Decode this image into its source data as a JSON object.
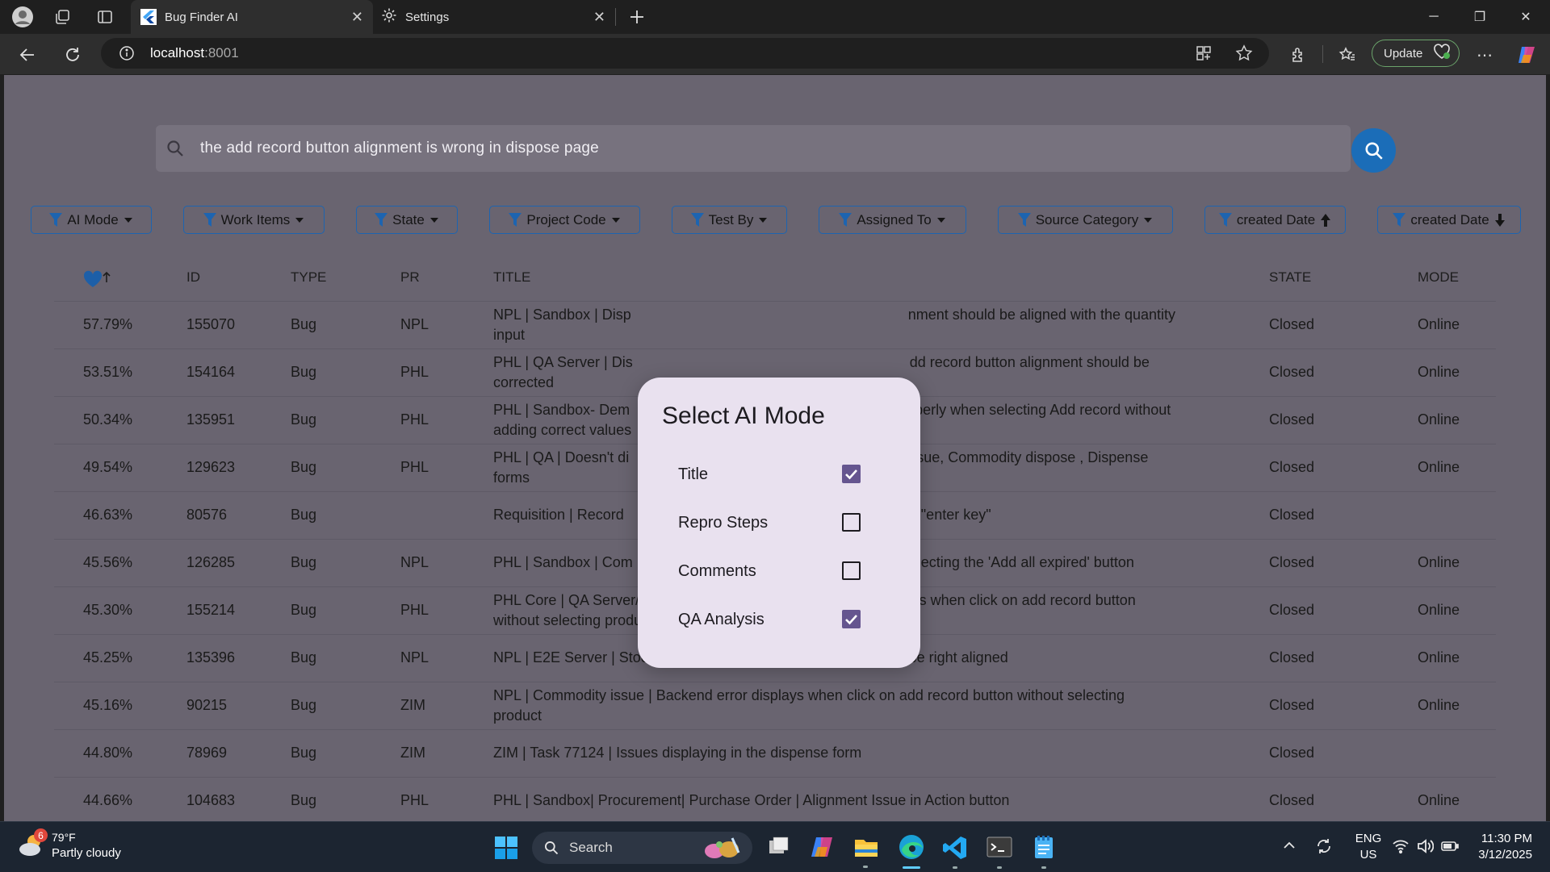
{
  "browser": {
    "tabs": [
      {
        "label": "Bug Finder AI",
        "active": true
      },
      {
        "label": "Settings",
        "active": false
      }
    ],
    "url_host": "localhost",
    "url_port": ":8001",
    "update_label": "Update"
  },
  "search": {
    "query": "the add record button alignment is wrong in dispose page"
  },
  "filters": [
    {
      "label": "AI Mode",
      "suffix": "dropdown"
    },
    {
      "label": "Work Items",
      "suffix": "dropdown"
    },
    {
      "label": "State",
      "suffix": "dropdown"
    },
    {
      "label": "Project Code",
      "suffix": "dropdown"
    },
    {
      "label": "Test By",
      "suffix": "dropdown"
    },
    {
      "label": "Assigned To",
      "suffix": "dropdown"
    },
    {
      "label": "Source Category",
      "suffix": "dropdown"
    },
    {
      "label": "created Date",
      "suffix": "sort-up"
    },
    {
      "label": "created Date",
      "suffix": "sort-down"
    }
  ],
  "table": {
    "columns": [
      "ID",
      "TYPE",
      "PR",
      "TITLE",
      "STATE",
      "MODE"
    ],
    "rows": [
      {
        "score": "57.79%",
        "id": "155070",
        "type": "Bug",
        "pr": "NPL",
        "title_left": "NPL | Sandbox | Disp",
        "title_right": "nment should be aligned with the quantity",
        "title_line2": "input",
        "state": "Closed",
        "mode": "Online"
      },
      {
        "score": "53.51%",
        "id": "154164",
        "type": "Bug",
        "pr": "PHL",
        "title_left": "PHL | QA Server | Dis",
        "title_right": "dd record button alignment should be",
        "title_line2": "corrected",
        "state": "Closed",
        "mode": "Online"
      },
      {
        "score": "50.34%",
        "id": "135951",
        "type": "Bug",
        "pr": "PHL",
        "title_left": "PHL | Sandbox- Dem",
        "title_right": "operly when selecting Add record  without",
        "title_line2": "adding correct values",
        "state": "Closed",
        "mode": "Online"
      },
      {
        "score": "49.54%",
        "id": "129623",
        "type": "Bug",
        "pr": "PHL",
        "title_left": "PHL | QA | Doesn't di",
        "title_right": "issue, Commodity dispose , Dispense",
        "title_line2": "forms",
        "state": "Closed",
        "mode": "Online"
      },
      {
        "score": "46.63%",
        "id": "80576",
        "type": "Bug",
        "pr": "",
        "title_left": "Requisition | Record",
        "title_right": "he \"enter key\"",
        "title_line2": "",
        "state": "Closed",
        "mode": ""
      },
      {
        "score": "45.56%",
        "id": "126285",
        "type": "Bug",
        "pr": "NPL",
        "title_left": "PHL | Sandbox | Com",
        "title_right": "electing the 'Add all expired' button",
        "title_line2": "",
        "state": "Closed",
        "mode": "Online"
      },
      {
        "score": "45.30%",
        "id": "155214",
        "type": "Bug",
        "pr": "PHL",
        "title_left": "PHL Core | QA Server/Live | Allocation List | Backend error displays when click on add record button",
        "title_right": "",
        "title_line2": "without selecting product details",
        "state": "Closed",
        "mode": "Online"
      },
      {
        "score": "45.25%",
        "id": "135396",
        "type": "Bug",
        "pr": "NPL",
        "title_left": "NPL | E2E Server | Stock Adjustment  | Add record button should be right aligned",
        "title_right": "",
        "title_line2": "",
        "state": "Closed",
        "mode": "Online"
      },
      {
        "score": "45.16%",
        "id": "90215",
        "type": "Bug",
        "pr": "ZIM",
        "title_left": "NPL | Commodity issue | Backend error displays when click on add record button without selecting",
        "title_right": "",
        "title_line2": "product",
        "state": "Closed",
        "mode": "Online"
      },
      {
        "score": "44.80%",
        "id": "78969",
        "type": "Bug",
        "pr": "ZIM",
        "title_left": "ZIM | Task 77124 | Issues displaying in the dispense form",
        "title_right": "",
        "title_line2": "",
        "state": "Closed",
        "mode": ""
      },
      {
        "score": "44.66%",
        "id": "104683",
        "type": "Bug",
        "pr": "PHL",
        "title_left": "PHL | Sandbox| Procurement| Purchase Order | Alignment Issue in Action button",
        "title_right": "",
        "title_line2": "",
        "state": "Closed",
        "mode": "Online"
      }
    ]
  },
  "modal": {
    "title": "Select AI Mode",
    "options": [
      {
        "label": "Title",
        "checked": true
      },
      {
        "label": "Repro Steps",
        "checked": false
      },
      {
        "label": "Comments",
        "checked": false
      },
      {
        "label": "QA Analysis",
        "checked": true
      }
    ]
  },
  "taskbar": {
    "weather_temp": "79°F",
    "weather_desc": "Partly cloudy",
    "weather_badge": "6",
    "search_label": "Search",
    "lang": "ENG",
    "region": "US",
    "time": "11:30 PM",
    "date": "3/12/2025"
  },
  "colors": {
    "accent": "#1d64b0",
    "app_bg": "#696470",
    "modal_bg": "#e9e1ef",
    "checkbox_on": "#65558f"
  }
}
